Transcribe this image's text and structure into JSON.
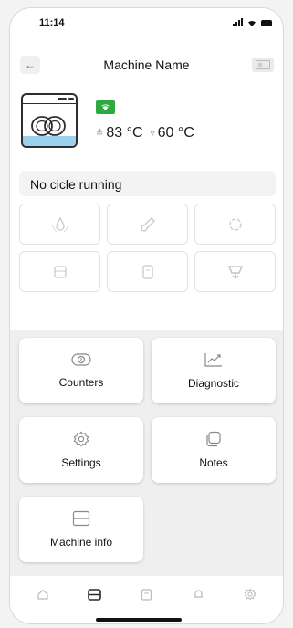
{
  "status_bar": {
    "time": "11:14"
  },
  "header": {
    "title": "Machine Name"
  },
  "machine": {
    "wash_temp": "83 °C",
    "rinse_temp": "60 °C",
    "status_color": "#2fa842"
  },
  "cycle": {
    "status_text": "No cicle running"
  },
  "function_grid": [
    {
      "icon": "detergent-icon"
    },
    {
      "icon": "thermometer-icon"
    },
    {
      "icon": "drying-icon"
    },
    {
      "icon": "tank-icon"
    },
    {
      "icon": "filter-icon"
    },
    {
      "icon": "drain-icon"
    }
  ],
  "menu_tiles": {
    "counters": "Counters",
    "diagnostic": "Diagnostic",
    "settings": "Settings",
    "notes": "Notes",
    "machine_info": "Machine info"
  },
  "tab_bar": [
    {
      "icon": "home-icon"
    },
    {
      "icon": "machine-icon",
      "active": true
    },
    {
      "icon": "calendar-icon"
    },
    {
      "icon": "bell-icon"
    },
    {
      "icon": "gear-icon"
    }
  ]
}
